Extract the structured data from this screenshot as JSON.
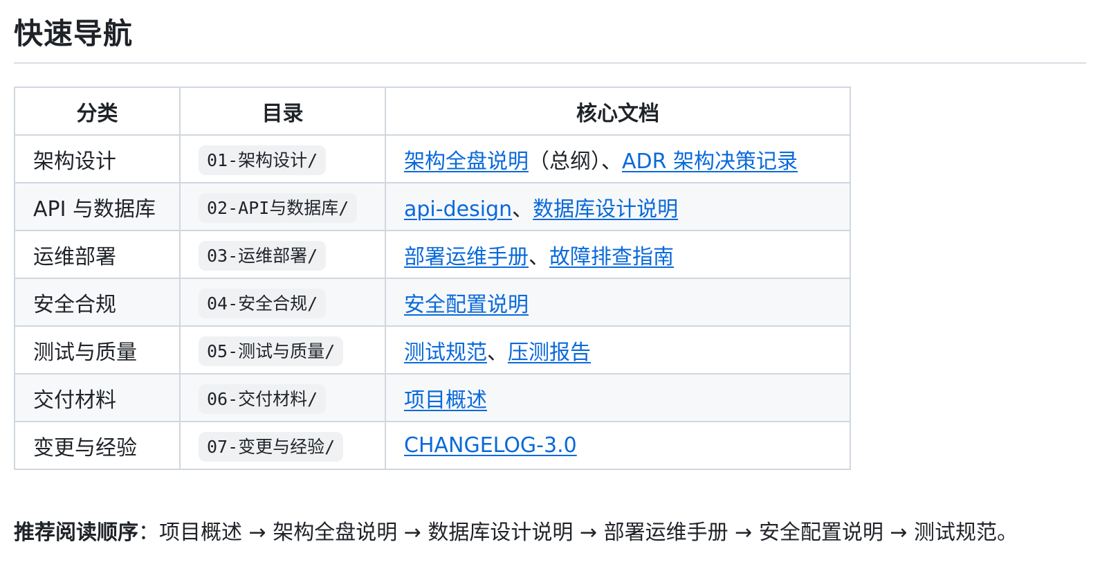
{
  "heading": "快速导航",
  "table": {
    "headers": [
      "分类",
      "目录",
      "核心文档"
    ],
    "rows": [
      {
        "category": "架构设计",
        "dir": "01-架构设计/",
        "docs": [
          {
            "text": "架构全盘说明",
            "link": true
          },
          {
            "text": "（总纲）、",
            "link": false
          },
          {
            "text": "ADR 架构决策记录",
            "link": true
          }
        ]
      },
      {
        "category": "API 与数据库",
        "dir": "02-API与数据库/",
        "docs": [
          {
            "text": "api-design",
            "link": true
          },
          {
            "text": "、",
            "link": false
          },
          {
            "text": "数据库设计说明",
            "link": true
          }
        ]
      },
      {
        "category": "运维部署",
        "dir": "03-运维部署/",
        "docs": [
          {
            "text": "部署运维手册",
            "link": true
          },
          {
            "text": "、",
            "link": false
          },
          {
            "text": "故障排查指南",
            "link": true
          }
        ]
      },
      {
        "category": "安全合规",
        "dir": "04-安全合规/",
        "docs": [
          {
            "text": "安全配置说明",
            "link": true
          }
        ]
      },
      {
        "category": "测试与质量",
        "dir": "05-测试与质量/",
        "docs": [
          {
            "text": "测试规范",
            "link": true
          },
          {
            "text": "、",
            "link": false
          },
          {
            "text": "压测报告",
            "link": true
          }
        ]
      },
      {
        "category": "交付材料",
        "dir": "06-交付材料/",
        "docs": [
          {
            "text": "项目概述",
            "link": true
          }
        ]
      },
      {
        "category": "变更与经验",
        "dir": "07-变更与经验/",
        "docs": [
          {
            "text": "CHANGELOG-3.0",
            "link": true
          }
        ]
      }
    ]
  },
  "reading_order": {
    "label": "推荐阅读顺序",
    "colon": "：",
    "text": "项目概述 → 架构全盘说明 → 数据库设计说明 → 部署运维手册 → 安全配置说明 → 测试规范。"
  },
  "colors": {
    "link": "#0969da",
    "border": "#d0d7de",
    "alt_row": "#f6f8fa",
    "code_bg": "#eff1f3"
  }
}
